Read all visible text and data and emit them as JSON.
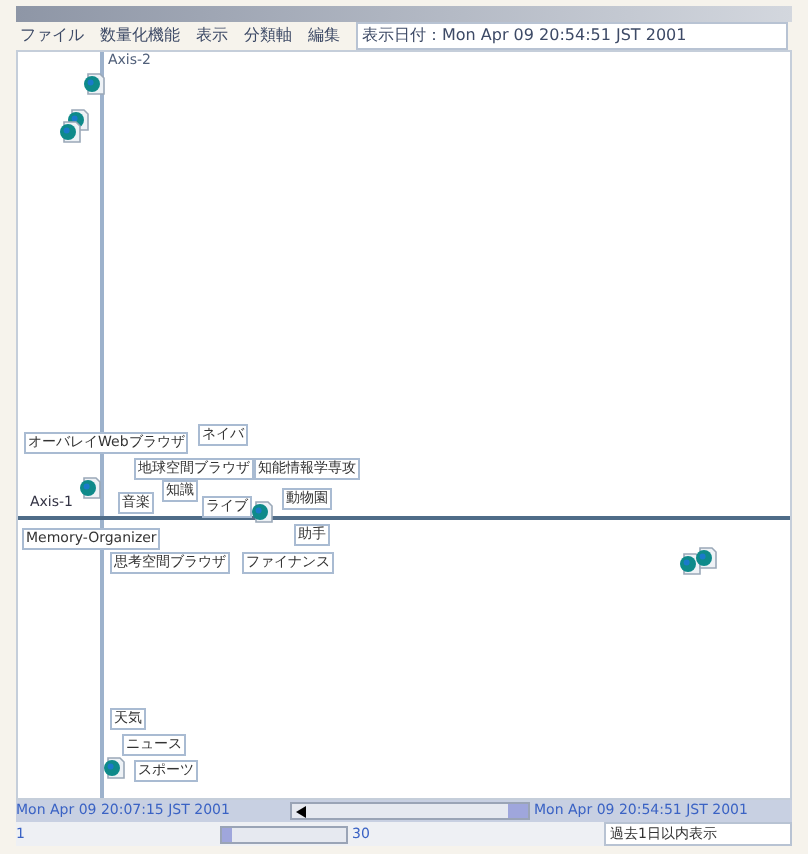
{
  "menu": [
    "ファイル",
    "数量化機能",
    "表示",
    "分類軸",
    "編集"
  ],
  "date_display": "表示日付：Mon Apr 09 20:54:51 JST 2001",
  "axes": {
    "vertical": "Axis-2",
    "horizontal": "Axis-1"
  },
  "nodes": [
    {
      "label": "オーバレイWebブラウザ"
    },
    {
      "label": "ネイバ"
    },
    {
      "label": "地球空間ブラウザ"
    },
    {
      "label": "知能情報学専攻"
    },
    {
      "label": "知識"
    },
    {
      "label": "ライブ"
    },
    {
      "label": "動物園"
    },
    {
      "label": "音楽"
    },
    {
      "label": "助手"
    },
    {
      "label": "Memory-Organizer"
    },
    {
      "label": "思考空間ブラウザ"
    },
    {
      "label": "ファイナンス"
    },
    {
      "label": "天気"
    },
    {
      "label": "ニュース"
    },
    {
      "label": "スポーツ"
    }
  ],
  "documents": [
    {
      "kind": "document"
    },
    {
      "kind": "document"
    },
    {
      "kind": "document"
    },
    {
      "kind": "document"
    },
    {
      "kind": "document"
    },
    {
      "kind": "document"
    },
    {
      "kind": "document"
    },
    {
      "kind": "document"
    }
  ],
  "timeline": {
    "start": "Mon Apr 09 20:07:15 JST 2001",
    "end": "Mon Apr 09 20:54:51 JST 2001"
  },
  "range": {
    "min": "1",
    "max": "30",
    "level": 0.08,
    "status": "過去1日以内表示"
  }
}
